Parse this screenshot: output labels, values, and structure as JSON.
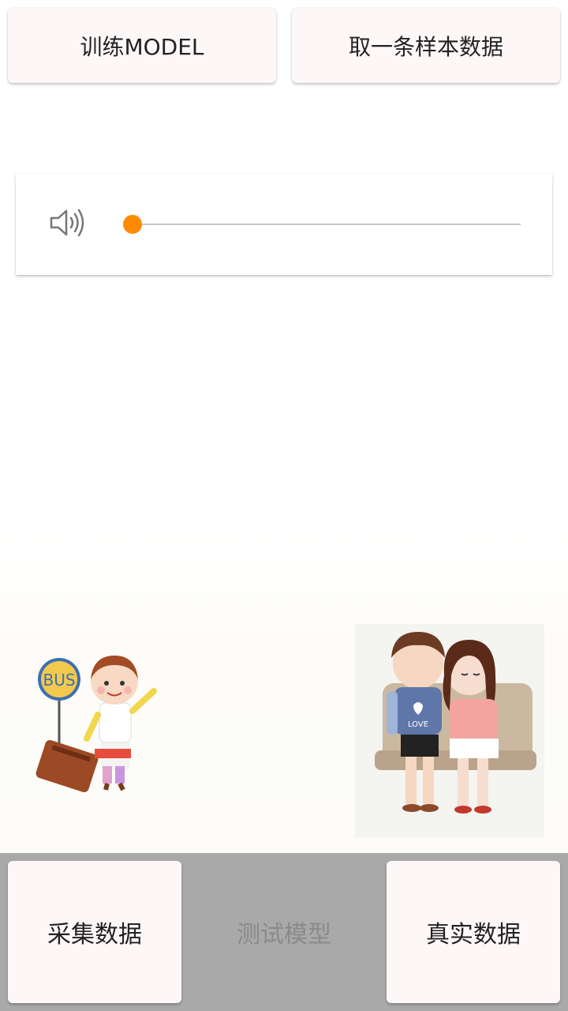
{
  "top_buttons": {
    "train_label": "训练MODEL",
    "sample_label": "取一条样本数据"
  },
  "volume": {
    "icon": "speaker-icon",
    "level": 0,
    "thumb_color": "#ff8a00"
  },
  "illustration": {
    "left_icon": "girl-with-suitcase-bus-stop-illustration",
    "right_icon": "couple-on-bench-illustration",
    "bus_sign_text": "BUS",
    "shirt_text": "LOVE"
  },
  "bottom_buttons": {
    "collect_label": "采集数据",
    "test_label": "测试模型",
    "real_label": "真实数据"
  },
  "colors": {
    "accent": "#ff8a00",
    "bottom_bar": "#a9a9a9",
    "button_bg": "#fdf8f7"
  }
}
